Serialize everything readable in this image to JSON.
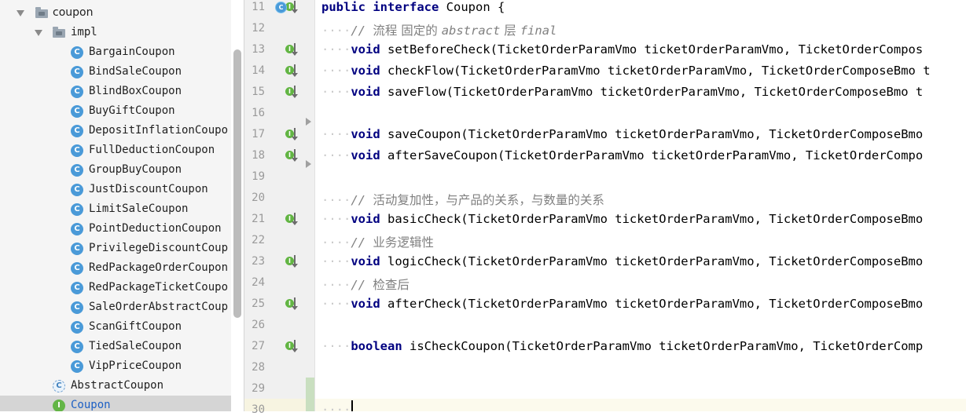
{
  "tree": {
    "package_coupon": "coupon",
    "package_impl": "impl",
    "impl_classes": [
      "BargainCoupon",
      "BindSaleCoupon",
      "BlindBoxCoupon",
      "BuyGiftCoupon",
      "DepositInflationCoupo",
      "FullDeductionCoupon",
      "GroupBuyCoupon",
      "JustDiscountCoupon",
      "LimitSaleCoupon",
      "PointDeductionCoupon",
      "PrivilegeDiscountCoup",
      "RedPackageOrderCoupon",
      "RedPackageTicketCoupo",
      "SaleOrderAbstractCoup",
      "ScanGiftCoupon",
      "TiedSaleCoupon",
      "VipPriceCoupon"
    ],
    "abstract_class": "AbstractCoupon",
    "interface_class": "Coupon",
    "icon_class": "C",
    "icon_interface": "I"
  },
  "editor": {
    "line_numbers": [
      "11",
      "12",
      "13",
      "14",
      "15",
      "16",
      "17",
      "18",
      "19",
      "20",
      "21",
      "22",
      "23",
      "24",
      "25",
      "26",
      "27",
      "28",
      "29",
      "30"
    ],
    "lines": {
      "l11": {
        "kw1": "public",
        "kw2": "interface",
        "rest": " Coupon {"
      },
      "l12": {
        "indent": "····",
        "prefix": "// ",
        "cn1": "流程 固定的 ",
        "it1": "abstract",
        "cn2": " 层 ",
        "it2": "final"
      },
      "l13": {
        "indent": "····",
        "kw": "void",
        "rest": " setBeforeCheck(TicketOrderParamVmo ticketOrderParamVmo, TicketOrderCompos"
      },
      "l14": {
        "indent": "····",
        "kw": "void",
        "rest": " checkFlow(TicketOrderParamVmo ticketOrderParamVmo, TicketOrderComposeBmo t"
      },
      "l15": {
        "indent": "····",
        "kw": "void",
        "rest": " saveFlow(TicketOrderParamVmo ticketOrderParamVmo, TicketOrderComposeBmo t"
      },
      "l17": {
        "indent": "····",
        "kw": "void",
        "rest": " saveCoupon(TicketOrderParamVmo ticketOrderParamVmo, TicketOrderComposeBmo"
      },
      "l18": {
        "indent": "····",
        "kw": "void",
        "rest": " afterSaveCoupon(TicketOrderParamVmo ticketOrderParamVmo, TicketOrderCompo"
      },
      "l20": {
        "indent": "····",
        "prefix": "// ",
        "cn": "活动复加性，与产品的关系，与数量的关系"
      },
      "l21": {
        "indent": "····",
        "kw": "void",
        "rest": " basicCheck(TicketOrderParamVmo ticketOrderParamVmo, TicketOrderComposeBmo"
      },
      "l22": {
        "indent": "····",
        "prefix": "// ",
        "cn": "业务逻辑性"
      },
      "l23": {
        "indent": "····",
        "kw": "void",
        "rest": " logicCheck(TicketOrderParamVmo ticketOrderParamVmo, TicketOrderComposeBmo"
      },
      "l24": {
        "indent": "····",
        "prefix": "// ",
        "cn": "检查后"
      },
      "l25": {
        "indent": "····",
        "kw": "void",
        "rest": " afterCheck(TicketOrderParamVmo ticketOrderParamVmo, TicketOrderComposeBmo"
      },
      "l27": {
        "indent": "····",
        "kw": "boolean",
        "rest": " isCheckCoupon(TicketOrderParamVmo ticketOrderParamVmo, TicketOrderComp"
      },
      "l30": {
        "indent": "····"
      }
    },
    "gutter_impl_icon": "I",
    "gutter_class_icon": "C"
  },
  "colors": {
    "keyword": "#000080",
    "comment": "#808080",
    "selected_row": "#d5d5d5",
    "interface_icon": "#63b546",
    "class_icon": "#4a9ad8",
    "link_text": "#1c5fc4"
  }
}
